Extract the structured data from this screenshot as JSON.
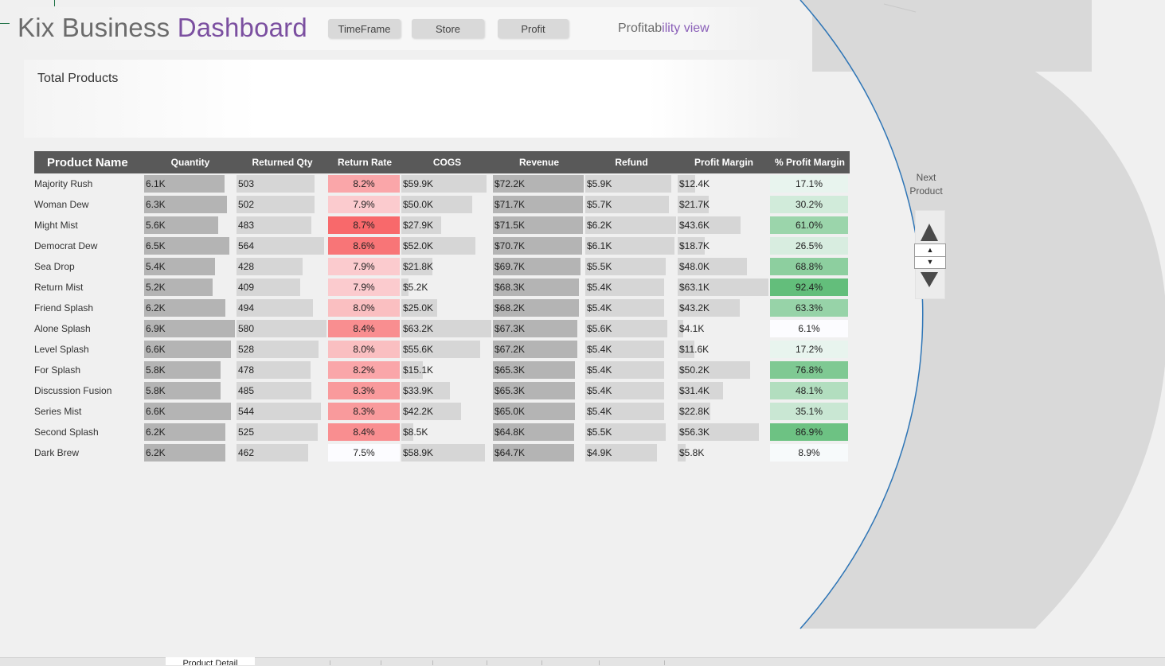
{
  "title": {
    "part1": "Kix Business ",
    "part2": "Dashboard"
  },
  "slicers": [
    {
      "label": "TimeFrame"
    },
    {
      "label": "Store"
    },
    {
      "label": "Profit"
    }
  ],
  "view_label": {
    "part1": "Profitab",
    "part2": "ility view"
  },
  "total_label": "Total Products",
  "table": {
    "headers": [
      "Product Name",
      "Quantity",
      "Returned Qty",
      "Return Rate",
      "COGS",
      "Revenue",
      "Refund",
      "Profit Margin",
      "% Profit Margin"
    ],
    "rows": [
      {
        "name": "Majority Rush",
        "quantity": "6.1K",
        "returned_qty": "503",
        "return_rate": "8.2%",
        "cogs": "$59.9K",
        "revenue": "$72.2K",
        "refund": "$5.9K",
        "profit_margin": "$12.4K",
        "pct_profit_margin": "17.1%",
        "q": 6.1,
        "rq": 503,
        "rr": 8.2,
        "c": 59.9,
        "rv": 72.2,
        "rf": 5.9,
        "pm": 12.4,
        "ppm": 17.1
      },
      {
        "name": "Woman Dew",
        "quantity": "6.3K",
        "returned_qty": "502",
        "return_rate": "7.9%",
        "cogs": "$50.0K",
        "revenue": "$71.7K",
        "refund": "$5.7K",
        "profit_margin": "$21.7K",
        "pct_profit_margin": "30.2%",
        "q": 6.3,
        "rq": 502,
        "rr": 7.9,
        "c": 50.0,
        "rv": 71.7,
        "rf": 5.7,
        "pm": 21.7,
        "ppm": 30.2
      },
      {
        "name": "Might Mist",
        "quantity": "5.6K",
        "returned_qty": "483",
        "return_rate": "8.7%",
        "cogs": "$27.9K",
        "revenue": "$71.5K",
        "refund": "$6.2K",
        "profit_margin": "$43.6K",
        "pct_profit_margin": "61.0%",
        "q": 5.6,
        "rq": 483,
        "rr": 8.7,
        "c": 27.9,
        "rv": 71.5,
        "rf": 6.2,
        "pm": 43.6,
        "ppm": 61.0
      },
      {
        "name": "Democrat Dew",
        "quantity": "6.5K",
        "returned_qty": "564",
        "return_rate": "8.6%",
        "cogs": "$52.0K",
        "revenue": "$70.7K",
        "refund": "$6.1K",
        "profit_margin": "$18.7K",
        "pct_profit_margin": "26.5%",
        "q": 6.5,
        "rq": 564,
        "rr": 8.6,
        "c": 52.0,
        "rv": 70.7,
        "rf": 6.1,
        "pm": 18.7,
        "ppm": 26.5
      },
      {
        "name": "Sea Drop",
        "quantity": "5.4K",
        "returned_qty": "428",
        "return_rate": "7.9%",
        "cogs": "$21.8K",
        "revenue": "$69.7K",
        "refund": "$5.5K",
        "profit_margin": "$48.0K",
        "pct_profit_margin": "68.8%",
        "q": 5.4,
        "rq": 428,
        "rr": 7.9,
        "c": 21.8,
        "rv": 69.7,
        "rf": 5.5,
        "pm": 48.0,
        "ppm": 68.8
      },
      {
        "name": "Return Mist",
        "quantity": "5.2K",
        "returned_qty": "409",
        "return_rate": "7.9%",
        "cogs": "$5.2K",
        "revenue": "$68.3K",
        "refund": "$5.4K",
        "profit_margin": "$63.1K",
        "pct_profit_margin": "92.4%",
        "q": 5.2,
        "rq": 409,
        "rr": 7.9,
        "c": 5.2,
        "rv": 68.3,
        "rf": 5.4,
        "pm": 63.1,
        "ppm": 92.4
      },
      {
        "name": "Friend Splash",
        "quantity": "6.2K",
        "returned_qty": "494",
        "return_rate": "8.0%",
        "cogs": "$25.0K",
        "revenue": "$68.2K",
        "refund": "$5.4K",
        "profit_margin": "$43.2K",
        "pct_profit_margin": "63.3%",
        "q": 6.2,
        "rq": 494,
        "rr": 8.0,
        "c": 25.0,
        "rv": 68.2,
        "rf": 5.4,
        "pm": 43.2,
        "ppm": 63.3
      },
      {
        "name": "Alone Splash",
        "quantity": "6.9K",
        "returned_qty": "580",
        "return_rate": "8.4%",
        "cogs": "$63.2K",
        "revenue": "$67.3K",
        "refund": "$5.6K",
        "profit_margin": "$4.1K",
        "pct_profit_margin": "6.1%",
        "q": 6.9,
        "rq": 580,
        "rr": 8.4,
        "c": 63.2,
        "rv": 67.3,
        "rf": 5.6,
        "pm": 4.1,
        "ppm": 6.1
      },
      {
        "name": "Level Splash",
        "quantity": "6.6K",
        "returned_qty": "528",
        "return_rate": "8.0%",
        "cogs": "$55.6K",
        "revenue": "$67.2K",
        "refund": "$5.4K",
        "profit_margin": "$11.6K",
        "pct_profit_margin": "17.2%",
        "q": 6.6,
        "rq": 528,
        "rr": 8.0,
        "c": 55.6,
        "rv": 67.2,
        "rf": 5.4,
        "pm": 11.6,
        "ppm": 17.2
      },
      {
        "name": "For Splash",
        "quantity": "5.8K",
        "returned_qty": "478",
        "return_rate": "8.2%",
        "cogs": "$15.1K",
        "revenue": "$65.3K",
        "refund": "$5.4K",
        "profit_margin": "$50.2K",
        "pct_profit_margin": "76.8%",
        "q": 5.8,
        "rq": 478,
        "rr": 8.2,
        "c": 15.1,
        "rv": 65.3,
        "rf": 5.4,
        "pm": 50.2,
        "ppm": 76.8
      },
      {
        "name": "Discussion Fusion",
        "quantity": "5.8K",
        "returned_qty": "485",
        "return_rate": "8.3%",
        "cogs": "$33.9K",
        "revenue": "$65.3K",
        "refund": "$5.4K",
        "profit_margin": "$31.4K",
        "pct_profit_margin": "48.1%",
        "q": 5.8,
        "rq": 485,
        "rr": 8.3,
        "c": 33.9,
        "rv": 65.3,
        "rf": 5.4,
        "pm": 31.4,
        "ppm": 48.1
      },
      {
        "name": "Series Mist",
        "quantity": "6.6K",
        "returned_qty": "544",
        "return_rate": "8.3%",
        "cogs": "$42.2K",
        "revenue": "$65.0K",
        "refund": "$5.4K",
        "profit_margin": "$22.8K",
        "pct_profit_margin": "35.1%",
        "q": 6.6,
        "rq": 544,
        "rr": 8.3,
        "c": 42.2,
        "rv": 65.0,
        "rf": 5.4,
        "pm": 22.8,
        "ppm": 35.1
      },
      {
        "name": "Second Splash",
        "quantity": "6.2K",
        "returned_qty": "525",
        "return_rate": "8.4%",
        "cogs": "$8.5K",
        "revenue": "$64.8K",
        "refund": "$5.5K",
        "profit_margin": "$56.3K",
        "pct_profit_margin": "86.9%",
        "q": 6.2,
        "rq": 525,
        "rr": 8.4,
        "c": 8.5,
        "rv": 64.8,
        "rf": 5.5,
        "pm": 56.3,
        "ppm": 86.9
      },
      {
        "name": "Dark Brew",
        "quantity": "6.2K",
        "returned_qty": "462",
        "return_rate": "7.5%",
        "cogs": "$58.9K",
        "revenue": "$64.7K",
        "refund": "$4.9K",
        "profit_margin": "$5.8K",
        "pct_profit_margin": "8.9%",
        "q": 6.2,
        "rq": 462,
        "rr": 7.5,
        "c": 58.9,
        "rv": 64.7,
        "rf": 4.9,
        "pm": 5.8,
        "ppm": 8.9
      }
    ]
  },
  "spinner": {
    "label_line1": "Next",
    "label_line2": "Product",
    "up_glyph": "▲",
    "down_glyph": "▼"
  },
  "sheet_tab": {
    "label": "Product Detail"
  },
  "colors": {
    "title_purple": "#7b4fa0",
    "header_bg": "#595959",
    "bar_dark": "#b4b4b4",
    "bar_light": "#d6d6d6",
    "rate_low": "#fcfcff",
    "rate_high": "#f8696b",
    "pm_low": "#fcfcff",
    "pm_high": "#63be7b",
    "arc_blue": "#2e75b6",
    "shape_grey": "#d9d9d9"
  }
}
